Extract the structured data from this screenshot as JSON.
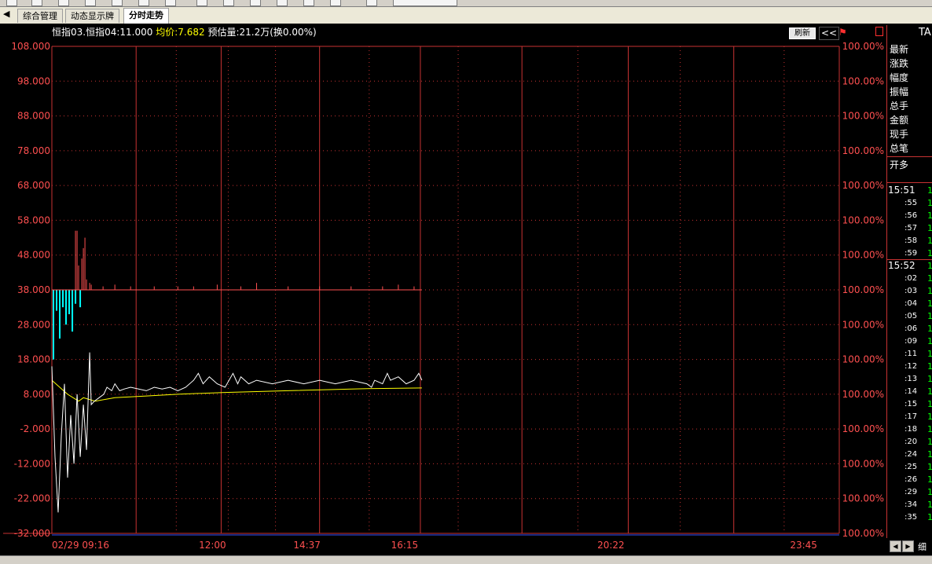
{
  "tabs": [
    {
      "label": "综合管理",
      "active": false
    },
    {
      "label": "动态显示牌",
      "active": false
    },
    {
      "label": "分时走势",
      "active": true
    }
  ],
  "header": {
    "symbol_label": "恒指03.恒指04:11.000",
    "avg_label": "均价:7.682",
    "volume_label": "预估量:21.2万(换0.00%)",
    "refresh_label": "刷新",
    "collapse_label": "<<"
  },
  "side_panel": {
    "title": "TA",
    "labels": [
      "最新",
      "涨跌",
      "幅度",
      "振幅",
      "总手",
      "金额",
      "现手",
      "总笔"
    ],
    "open_label": "开多",
    "ticks": [
      {
        "time": "15:51",
        "value": "1"
      },
      {
        "time": ":55",
        "value": "1"
      },
      {
        "time": ":56",
        "value": "1"
      },
      {
        "time": ":57",
        "value": "1"
      },
      {
        "time": ":58",
        "value": "1"
      },
      {
        "time": ":59",
        "value": "1"
      },
      {
        "time": "15:52",
        "value": "1"
      },
      {
        "time": ":02",
        "value": "1"
      },
      {
        "time": ":03",
        "value": "1"
      },
      {
        "time": ":04",
        "value": "1"
      },
      {
        "time": ":05",
        "value": "1"
      },
      {
        "time": ":06",
        "value": "1"
      },
      {
        "time": ":09",
        "value": "1"
      },
      {
        "time": ":11",
        "value": "1"
      },
      {
        "time": ":12",
        "value": "1"
      },
      {
        "time": ":13",
        "value": "1"
      },
      {
        "time": ":14",
        "value": "1"
      },
      {
        "time": ":15",
        "value": "1"
      },
      {
        "time": ":17",
        "value": "1"
      },
      {
        "time": ":18",
        "value": "1"
      },
      {
        "time": ":20",
        "value": "1"
      },
      {
        "time": ":24",
        "value": "1"
      },
      {
        "time": ":25",
        "value": "1"
      },
      {
        "time": ":26",
        "value": "1"
      },
      {
        "time": ":29",
        "value": "1"
      },
      {
        "time": ":34",
        "value": "1"
      },
      {
        "time": ":35",
        "value": "1"
      }
    ],
    "detail_label": "细"
  },
  "colors": {
    "grid": "#c83232",
    "axis_text": "#ff5050",
    "price": "#ffffff",
    "avg": "#ffff00",
    "bar_up": "#ff5050",
    "bar_down": "#00ffff",
    "background": "#000000"
  },
  "chart_data": {
    "type": "line",
    "x_labels": [
      "02/29 09:16",
      "12:00",
      "14:37",
      "16:15",
      "20:22",
      "23:45"
    ],
    "y_ticks": [
      "108.000",
      "98.000",
      "88.000",
      "78.000",
      "68.000",
      "58.000",
      "48.000",
      "38.000",
      "28.000",
      "18.000",
      "8.000",
      "-2.000",
      "-12.000",
      "-22.000",
      "-32.000"
    ],
    "pct_ticks": [
      "100.00%",
      "100.00%",
      "100.00%",
      "100.00%",
      "100.00%",
      "100.00%",
      "100.00%",
      "100.00%",
      "100.00%",
      "100.00%",
      "100.00%",
      "100.00%",
      "100.00%",
      "100.00%",
      "100.00%"
    ],
    "ylim": [
      -32,
      108
    ],
    "xlim": [
      0,
      100
    ],
    "baseline": 38,
    "price_series": [
      [
        0,
        16
      ],
      [
        0.4,
        -10
      ],
      [
        0.8,
        -26
      ],
      [
        1.2,
        -4
      ],
      [
        1.6,
        11
      ],
      [
        2.0,
        -16
      ],
      [
        2.4,
        2
      ],
      [
        2.8,
        -12
      ],
      [
        3.2,
        8
      ],
      [
        3.6,
        -10
      ],
      [
        4.0,
        5
      ],
      [
        4.4,
        -8
      ],
      [
        4.8,
        20
      ],
      [
        5.0,
        5
      ],
      [
        5.4,
        6
      ],
      [
        6.0,
        7
      ],
      [
        6.6,
        8
      ],
      [
        7.0,
        10
      ],
      [
        7.6,
        9
      ],
      [
        8.0,
        11
      ],
      [
        8.6,
        9
      ],
      [
        9.2,
        9.5
      ],
      [
        10,
        10
      ],
      [
        12,
        9
      ],
      [
        13,
        10
      ],
      [
        14,
        9.5
      ],
      [
        15,
        10
      ],
      [
        16,
        9
      ],
      [
        17,
        10
      ],
      [
        18,
        12
      ],
      [
        18.6,
        14
      ],
      [
        19.2,
        11
      ],
      [
        20,
        13
      ],
      [
        21,
        11
      ],
      [
        22,
        10
      ],
      [
        23,
        14
      ],
      [
        23.6,
        11
      ],
      [
        24,
        13
      ],
      [
        25,
        11
      ],
      [
        26,
        12
      ],
      [
        28,
        11
      ],
      [
        30,
        12
      ],
      [
        32,
        11
      ],
      [
        34,
        12
      ],
      [
        36,
        11
      ],
      [
        38,
        12
      ],
      [
        40,
        11
      ],
      [
        40.6,
        10
      ],
      [
        41,
        12
      ],
      [
        42,
        11
      ],
      [
        42.6,
        14
      ],
      [
        43,
        12
      ],
      [
        44,
        13
      ],
      [
        45,
        11
      ],
      [
        46,
        12
      ],
      [
        46.6,
        14
      ],
      [
        47,
        12
      ]
    ],
    "avg_series": [
      [
        0,
        12
      ],
      [
        2,
        8
      ],
      [
        3.4,
        6
      ],
      [
        4.0,
        7
      ],
      [
        5.5,
        6
      ],
      [
        8,
        7
      ],
      [
        12,
        7.5
      ],
      [
        16,
        8
      ],
      [
        22,
        8.5
      ],
      [
        30,
        9
      ],
      [
        40,
        9.6
      ],
      [
        47,
        9.8
      ]
    ],
    "volume_up": [
      [
        3.0,
        17
      ],
      [
        3.2,
        17
      ],
      [
        3.4,
        7
      ],
      [
        3.8,
        9
      ],
      [
        4.0,
        12
      ],
      [
        4.2,
        15
      ],
      [
        4.4,
        3
      ],
      [
        4.8,
        2
      ],
      [
        5.0,
        1.5
      ],
      [
        6.5,
        1
      ],
      [
        8.0,
        1.5
      ],
      [
        10,
        1
      ],
      [
        13,
        1
      ],
      [
        16,
        1
      ],
      [
        18,
        1
      ],
      [
        21,
        1.5
      ],
      [
        24,
        1
      ],
      [
        26,
        2
      ],
      [
        30,
        1
      ],
      [
        34,
        1
      ],
      [
        38,
        1
      ],
      [
        42,
        1
      ],
      [
        44,
        1.5
      ],
      [
        46,
        1
      ]
    ],
    "volume_down": [
      [
        0.2,
        20
      ],
      [
        0.6,
        6
      ],
      [
        1.0,
        14
      ],
      [
        1.4,
        5
      ],
      [
        1.8,
        10
      ],
      [
        2.2,
        7
      ],
      [
        2.6,
        12
      ],
      [
        3.0,
        4
      ],
      [
        3.6,
        5
      ]
    ]
  }
}
